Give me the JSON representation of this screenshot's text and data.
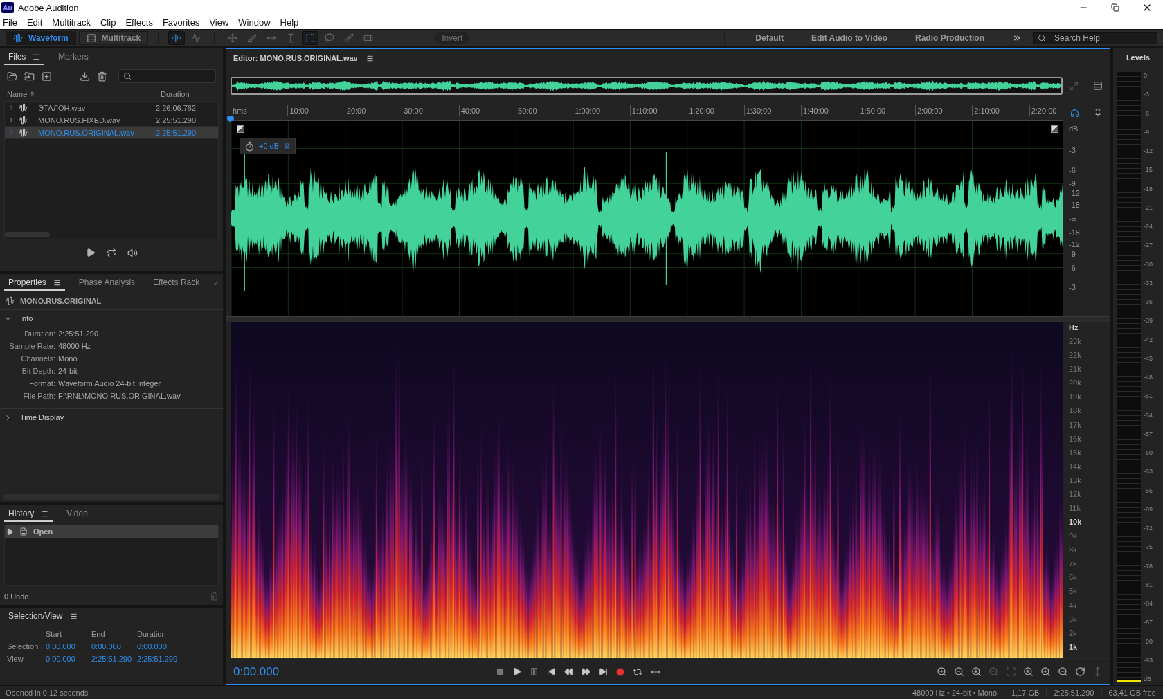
{
  "window": {
    "app_icon": "Au",
    "title": "Adobe Audition"
  },
  "menu": [
    "File",
    "Edit",
    "Multitrack",
    "Clip",
    "Effects",
    "Favorites",
    "View",
    "Window",
    "Help"
  ],
  "toolbar": {
    "modes": [
      {
        "label": "Waveform",
        "selected": true
      },
      {
        "label": "Multitrack",
        "selected": false
      }
    ],
    "display_buttons": [
      {
        "kind": "spectral",
        "selected": true
      },
      {
        "kind": "waveform",
        "selected": false
      }
    ],
    "tools": [
      {
        "kind": "move",
        "selected": false
      },
      {
        "kind": "razor",
        "selected": false
      },
      {
        "kind": "slip",
        "selected": false
      },
      {
        "kind": "time",
        "selected": false
      },
      {
        "kind": "marquee",
        "selected": true
      },
      {
        "kind": "lasso",
        "selected": false
      },
      {
        "kind": "brush",
        "selected": false
      },
      {
        "kind": "healing",
        "selected": false
      }
    ],
    "invert": {
      "label": "Invert",
      "disabled": true
    },
    "workspaces": [
      "Default",
      "Edit Audio to Video",
      "Radio Production"
    ],
    "search": {
      "placeholder": "Search Help"
    }
  },
  "files_panel": {
    "tabs": [
      {
        "label": "Files",
        "selected": true
      },
      {
        "label": "Markers",
        "selected": false
      }
    ],
    "columns": [
      "Name",
      "Duration"
    ],
    "rows": [
      {
        "name": "ЭТАЛОН.wav",
        "duration": "2:26:06.762",
        "selected": false
      },
      {
        "name": "MONO.RUS.FIXED.wav",
        "duration": "2:25:51.290",
        "selected": false
      },
      {
        "name": "MONO.RUS.ORIGINAL.wav",
        "duration": "2:25:51.290",
        "selected": true
      }
    ]
  },
  "properties_panel": {
    "tabs": [
      {
        "label": "Properties",
        "selected": true
      },
      {
        "label": "Phase Analysis",
        "selected": false
      },
      {
        "label": "Effects Rack",
        "selected": false
      }
    ],
    "file": "MONO.RUS.ORIGINAL",
    "sections": [
      {
        "title": "Info",
        "expanded": true,
        "fields": [
          {
            "label": "Duration:",
            "value": "2:25:51.290"
          },
          {
            "label": "Sample Rate:",
            "value": "48000 Hz"
          },
          {
            "label": "Channels:",
            "value": "Mono"
          },
          {
            "label": "Bit Depth:",
            "value": "24-bit"
          },
          {
            "label": "Format:",
            "value": "Waveform Audio 24-bit Integer"
          },
          {
            "label": "File Path:",
            "value": "F:\\RNL\\MONO.RUS.ORIGINAL.wav"
          }
        ]
      },
      {
        "title": "Time Display",
        "expanded": false
      }
    ]
  },
  "history_panel": {
    "tabs": [
      {
        "label": "History",
        "selected": true
      },
      {
        "label": "Video",
        "selected": false
      }
    ],
    "items": [
      {
        "label": "Open",
        "selected": true
      }
    ],
    "undo": "0 Undo"
  },
  "selection_view": {
    "title": "Selection/View",
    "columns": [
      "Start",
      "End",
      "Duration"
    ],
    "rows": [
      {
        "label": "Selection",
        "values": [
          "0:00.000",
          "0:00.000",
          "0:00.000"
        ]
      },
      {
        "label": "View",
        "values": [
          "0:00.000",
          "2:25:51.290",
          "2:25:51.290"
        ]
      }
    ]
  },
  "editor": {
    "title": "Editor: MONO.RUS.ORIGINAL.wav",
    "ruler": [
      "hms",
      "10:00",
      "20:00",
      "30:00",
      "40:00",
      "50:00",
      "1:00:00",
      "1:10:00",
      "1:20:00",
      "1:30:00",
      "1:40:00",
      "1:50:00",
      "2:00:00",
      "2:10:00",
      "2:20:00"
    ],
    "gain": "+0 dB",
    "amplitude_scale": [
      "dB",
      "-3",
      "-6",
      "-9",
      "-12",
      "-18",
      "-∞",
      "-18",
      "-12",
      "-9",
      "-6",
      "-3"
    ],
    "frequency_scale": [
      "Hz",
      "23k",
      "22k",
      "21k",
      "20k",
      "19k",
      "18k",
      "17k",
      "16k",
      "15k",
      "14k",
      "13k",
      "12k",
      "11k",
      "10k",
      "9k",
      "8k",
      "7k",
      "6k",
      "5k",
      "4k",
      "3k",
      "2k",
      "1k"
    ],
    "time": "0:00.000"
  },
  "levels": {
    "title": "Levels",
    "level": 0.005,
    "scale": [
      "0",
      "-3",
      "-6",
      "-9",
      "-12",
      "-15",
      "-18",
      "-21",
      "-24",
      "-27",
      "-30",
      "-33",
      "-36",
      "-39",
      "-42",
      "-45",
      "-48",
      "-51",
      "-54",
      "-57",
      "-60",
      "-63",
      "-66",
      "-69",
      "-72",
      "-75",
      "-78",
      "-81",
      "-84",
      "-87",
      "-90",
      "-93",
      "dB"
    ]
  },
  "status": {
    "message": "Opened in 0,12 seconds",
    "fields": [
      "48000 Hz • 24-bit • Mono",
      "1,17 GB",
      "2:25:51.290",
      "63,41 GB free"
    ]
  }
}
